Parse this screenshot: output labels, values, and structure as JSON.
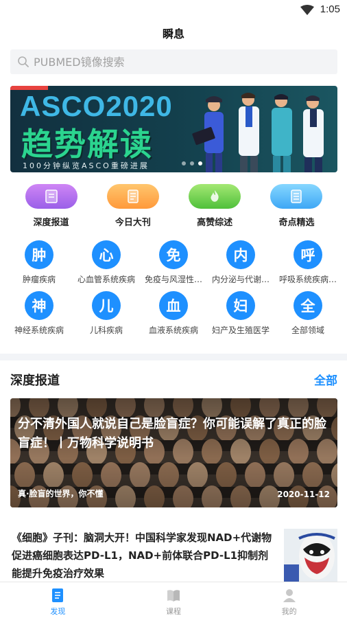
{
  "status": {
    "time": "1:05",
    "wifi_icon": "wifi-icon"
  },
  "header": {
    "title": "瞬息"
  },
  "search": {
    "placeholder": "PUBMED镜像搜索",
    "icon": "search-icon"
  },
  "banner": {
    "line1": "ASCO2020",
    "line2": "趋势解读",
    "line3": "100分钟纵览ASCO重磅进展",
    "dots": 3,
    "active_dot": 2
  },
  "quick_links": [
    {
      "label": "深度报道",
      "color_from": "#c87af0",
      "color_to": "#9a5fe8"
    },
    {
      "label": "今日大刊",
      "color_from": "#ffc36b",
      "color_to": "#ff9a3c"
    },
    {
      "label": "高赞综述",
      "color_from": "#9be36b",
      "color_to": "#53c43d"
    },
    {
      "label": "奇点精选",
      "color_from": "#7fd3ff",
      "color_to": "#3fa8f5"
    }
  ],
  "categories": [
    {
      "char": "肿",
      "label": "肿瘤疾病"
    },
    {
      "char": "心",
      "label": "心血管系统疾病"
    },
    {
      "char": "免",
      "label": "免疫与风湿性…"
    },
    {
      "char": "内",
      "label": "内分泌与代谢…"
    },
    {
      "char": "呼",
      "label": "呼吸系统疾病…"
    },
    {
      "char": "神",
      "label": "神经系统疾病"
    },
    {
      "char": "儿",
      "label": "儿科疾病"
    },
    {
      "char": "血",
      "label": "血液系统疾病"
    },
    {
      "char": "妇",
      "label": "妇产及生殖医学"
    },
    {
      "char": "全",
      "label": "全部领域"
    }
  ],
  "section": {
    "title": "深度报道",
    "all_label": "全部"
  },
  "feature": {
    "title": "分不清外国人就说自己是脸盲症？你可能误解了真正的脸盲症！丨万物科学说明书",
    "source": "真·脸盲的世界，你不懂",
    "date": "2020-11-12"
  },
  "article": {
    "title": "《细胞》子刊：脑洞大开！中国科学家发现NAD+代谢物促进癌细胞表达PD-L1，NAD+前体联合PD-L1抑制剂能提升免疫治疗效果"
  },
  "tabs": [
    {
      "label": "发现",
      "icon": "discover-icon",
      "active": true
    },
    {
      "label": "课程",
      "icon": "book-icon",
      "active": false
    },
    {
      "label": "我的",
      "icon": "profile-icon",
      "active": false
    }
  ],
  "colors": {
    "accent": "#1e90ff",
    "section_bg": "#f2f4f7"
  }
}
